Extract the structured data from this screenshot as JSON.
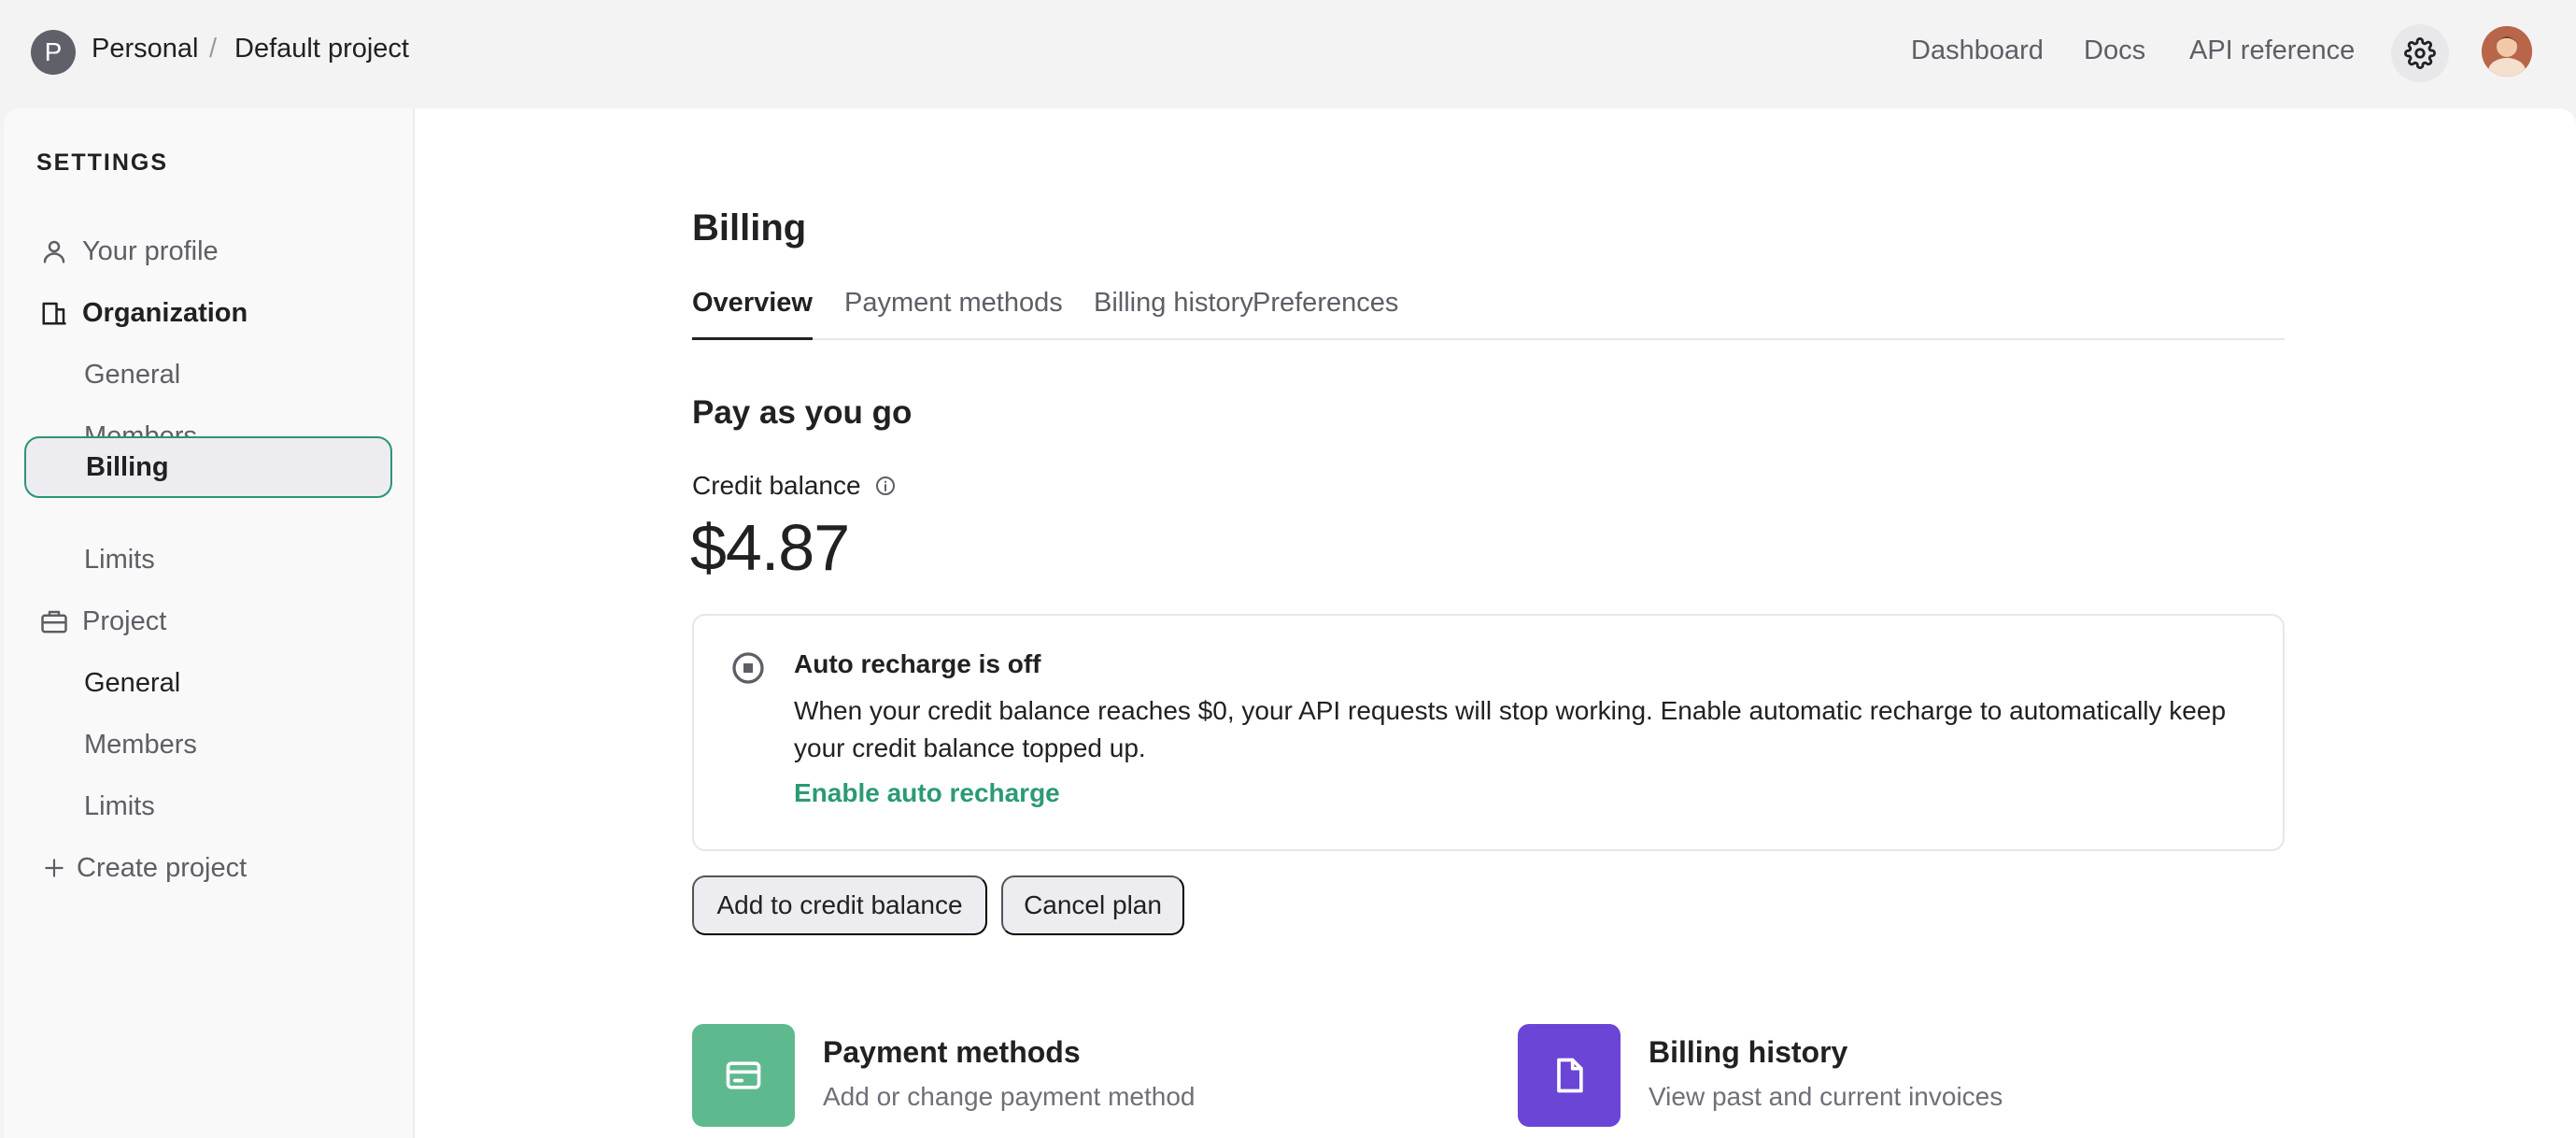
{
  "header": {
    "org_initial": "P",
    "org_name": "Personal",
    "separator": "/",
    "project_name": "Default project",
    "nav": [
      "Dashboard",
      "Docs",
      "API reference"
    ],
    "icons": {
      "settings": "gear-icon",
      "avatar": "user-avatar"
    }
  },
  "sidebar": {
    "heading": "SETTINGS",
    "items": [
      {
        "label": "Your profile",
        "icon": "person-icon"
      },
      {
        "label": "Organization",
        "icon": "building-icon"
      },
      {
        "label": "General"
      },
      {
        "label": "Members"
      },
      {
        "label": "Billing",
        "active": true
      },
      {
        "label": "Limits"
      },
      {
        "label": "Project",
        "icon": "briefcase-icon"
      },
      {
        "label": "General"
      },
      {
        "label": "Members"
      },
      {
        "label": "Limits"
      },
      {
        "label": "Create project",
        "icon": "plus-icon"
      }
    ]
  },
  "main": {
    "title": "Billing",
    "tabs": [
      {
        "label": "Overview",
        "active": true
      },
      {
        "label": "Payment methods"
      },
      {
        "label": "Billing history"
      },
      {
        "label": "Preferences"
      }
    ],
    "plan_title": "Pay as you go",
    "credit_label": "Credit balance",
    "credit_value": "$4.87",
    "recharge": {
      "title": "Auto recharge is off",
      "description": "When your credit balance reaches $0, your API requests will stop working. Enable automatic recharge to automatically keep your credit balance topped up.",
      "link": "Enable auto recharge"
    },
    "buttons": {
      "add": "Add to credit balance",
      "cancel": "Cancel plan"
    },
    "cards": [
      {
        "title": "Payment methods",
        "subtitle": "Add or change payment method",
        "icon": "credit-card-icon"
      },
      {
        "title": "Billing history",
        "subtitle": "View past and current invoices",
        "icon": "document-icon"
      }
    ]
  },
  "colors": {
    "accent_green": "#2b9a76",
    "active_border": "#2c9475",
    "payment_tile": "#5fb98e",
    "history_tile": "#6b45d6"
  }
}
